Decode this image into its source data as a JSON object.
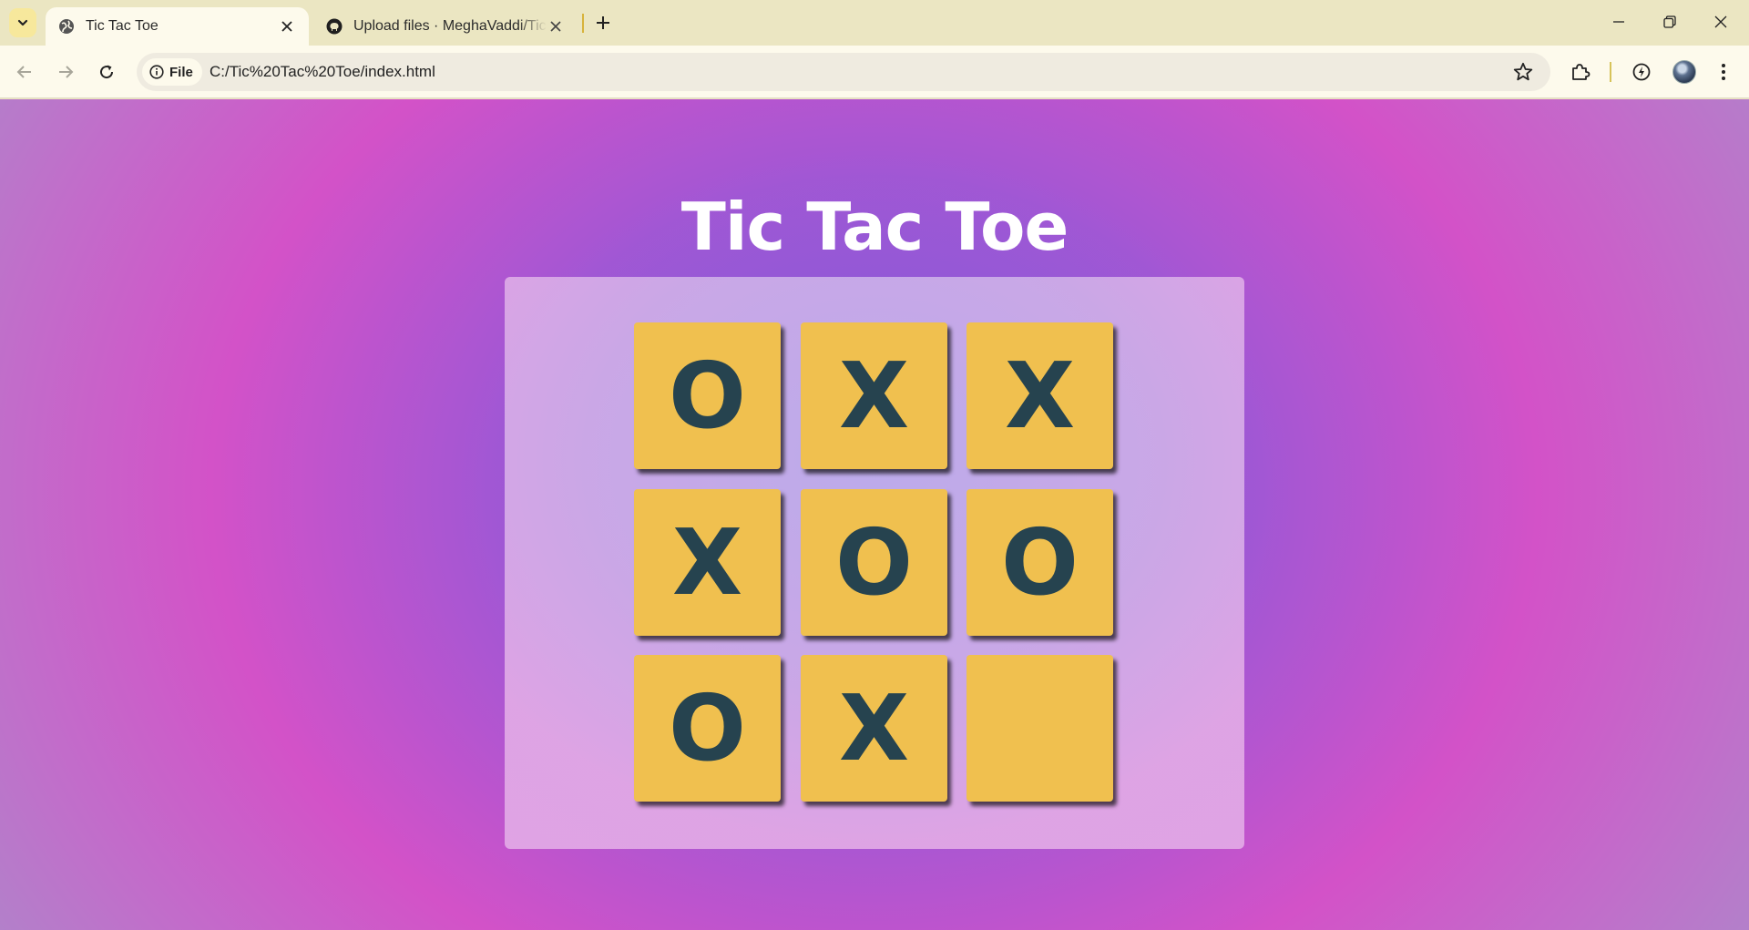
{
  "browser": {
    "tabs": [
      {
        "title": "Tic Tac Toe",
        "active": true,
        "favicon": "globe-icon"
      },
      {
        "title": "Upload files · MeghaVaddi/Tic-Tac-Toe",
        "active": false,
        "favicon": "github-icon"
      }
    ],
    "address": {
      "chip_label": "File",
      "url": "C:/Tic%20Tac%20Toe/index.html"
    }
  },
  "game": {
    "title": "Tic Tac Toe",
    "board": [
      [
        "O",
        "X",
        "X"
      ],
      [
        "X",
        "O",
        "O"
      ],
      [
        "O",
        "X",
        ""
      ]
    ]
  },
  "colors": {
    "cell": "#f0c04f",
    "mark": "#26434f",
    "title": "#ffffff"
  }
}
